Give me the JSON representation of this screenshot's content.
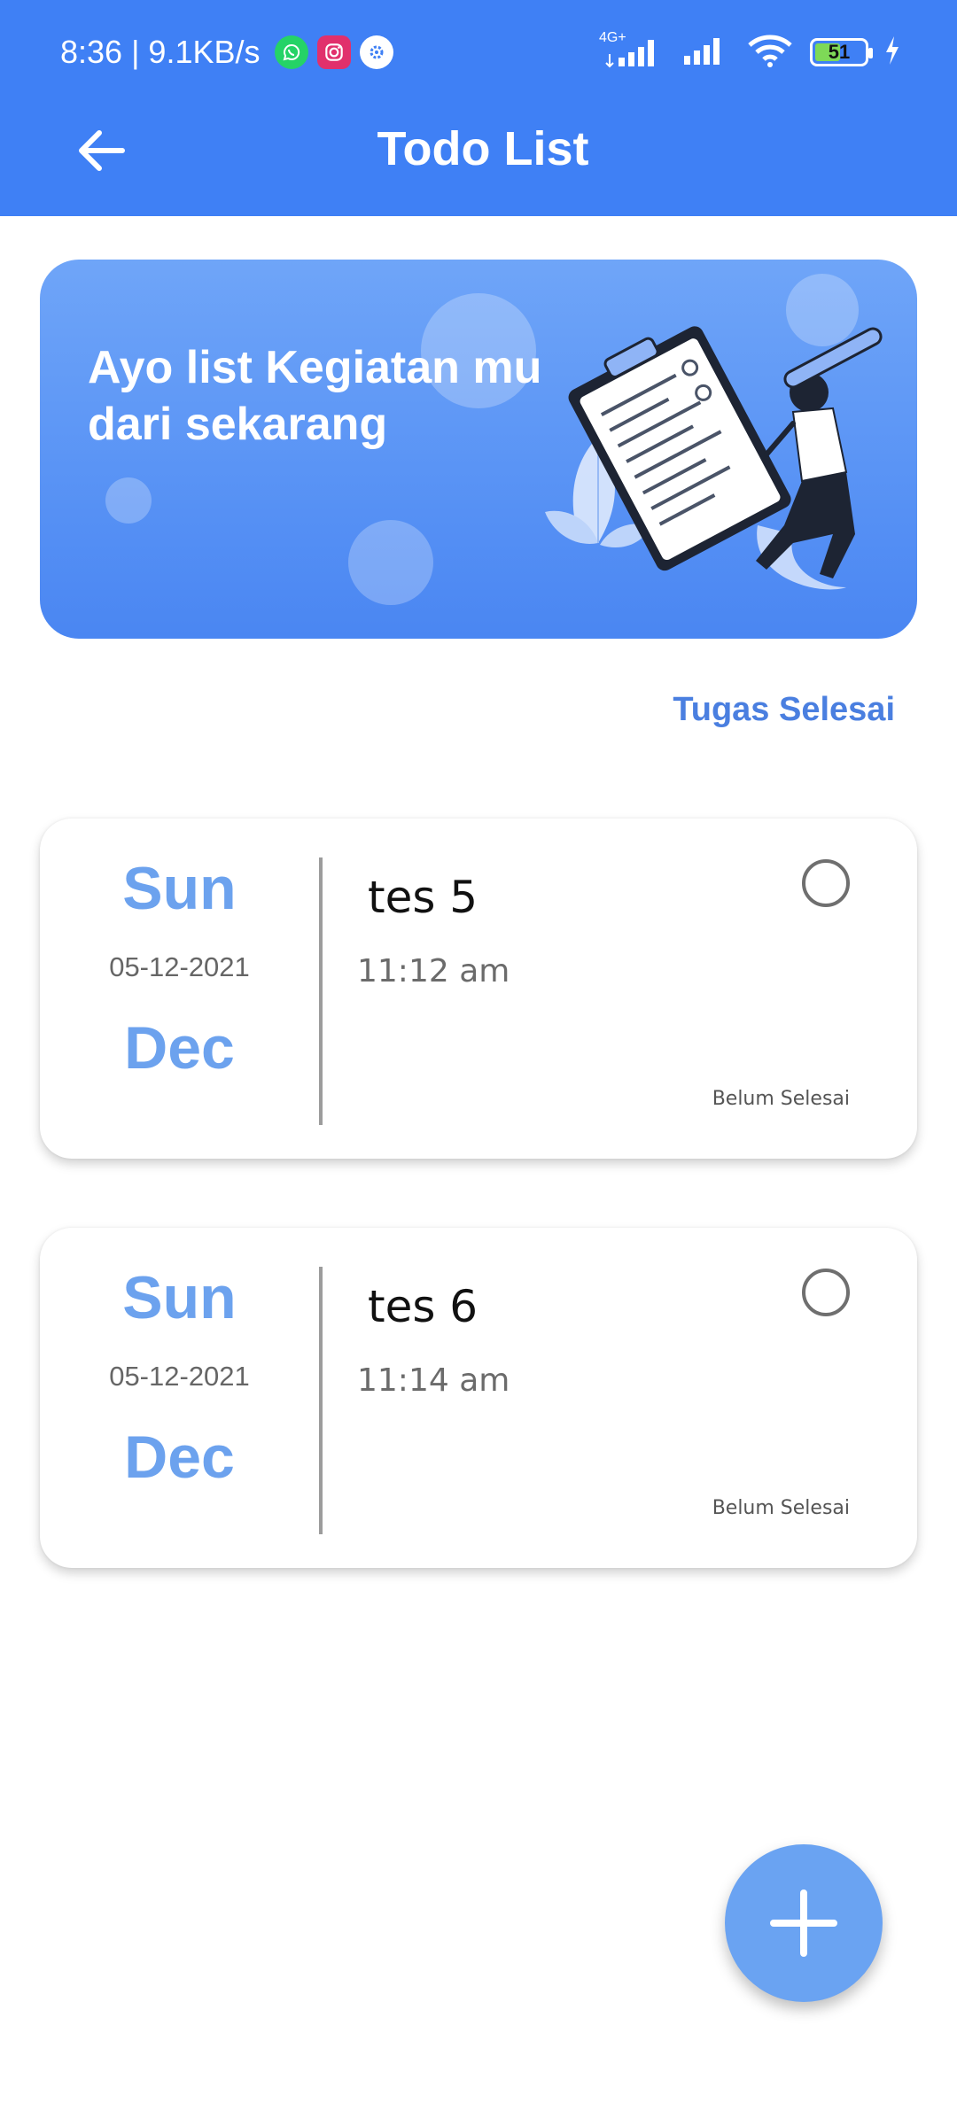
{
  "status_bar": {
    "time_speed": "8:36 | 9.1KB/s",
    "network_type": "4G+",
    "battery": "51",
    "battery_level": 0.51,
    "icons": [
      "whatsapp-icon",
      "instagram-icon",
      "settings-icon",
      "signal-icon",
      "signal-icon",
      "wifi-icon",
      "battery-icon",
      "charging-icon"
    ]
  },
  "app_bar": {
    "title": "Todo List",
    "back_icon": "back-arrow-icon"
  },
  "banner": {
    "text": "Ayo list Kegiatan mu dari sekarang",
    "illustration": "clipboard-person-illustration"
  },
  "done_link": "Tugas Selesai",
  "tasks": [
    {
      "day": "Sun",
      "date": "05-12-2021",
      "month": "Dec",
      "title": "tes 5",
      "time": "11:12 am",
      "status": "Belum Selesai",
      "checked": false
    },
    {
      "day": "Sun",
      "date": "05-12-2021",
      "month": "Dec",
      "title": "tes 6",
      "time": "11:14 am",
      "status": "Belum Selesai",
      "checked": false
    }
  ],
  "fab": {
    "icon": "plus-icon"
  },
  "colors": {
    "primary": "#3f80f5",
    "accent": "#6ca2ee",
    "link": "#4a7fe0",
    "fab": "#6aa3f2"
  }
}
